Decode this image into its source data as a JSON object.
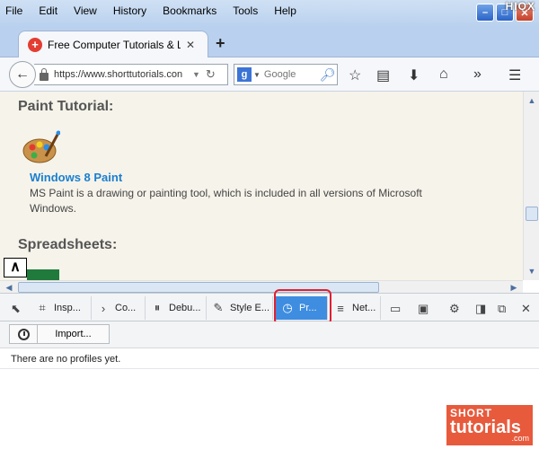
{
  "menu": {
    "items": [
      "File",
      "Edit",
      "View",
      "History",
      "Bookmarks",
      "Tools",
      "Help"
    ]
  },
  "window": {
    "minimize": "–",
    "maximize": "□",
    "close": "✕",
    "brand": "HIOX"
  },
  "tab": {
    "title": "Free Computer Tutorials & Le...",
    "close": "✕",
    "new_tab": "+"
  },
  "navbar": {
    "url": "https://www.shorttutorials.con",
    "search_placeholder": "Google",
    "search_engine": "g"
  },
  "page": {
    "heading_paint": "Paint Tutorial:",
    "link_paint": "Windows 8 Paint",
    "description": "MS Paint is a drawing or painting tool, which is included in all versions of Microsoft Windows.",
    "heading_spreadsheets": "Spreadsheets:"
  },
  "devtools": {
    "tabs": [
      {
        "label": "Insp...",
        "icon": "inspector-icon"
      },
      {
        "label": "Co...",
        "icon": "console-icon"
      },
      {
        "label": "Debu...",
        "icon": "debugger-icon"
      },
      {
        "label": "Style E...",
        "icon": "style-editor-icon"
      },
      {
        "label": "Pr...",
        "icon": "profiler-icon",
        "active": true
      },
      {
        "label": "Net...",
        "icon": "network-icon"
      }
    ]
  },
  "profiler": {
    "import_label": "Import...",
    "empty_message": "There are no profiles yet."
  },
  "watermark": {
    "top": "SHORT",
    "big": "tutorials",
    "com": ".com"
  },
  "colors": {
    "active_tab": "#3e8de0",
    "highlight": "#e01f2f",
    "link": "#1a7fd0",
    "watermark": "#e85a3c"
  }
}
